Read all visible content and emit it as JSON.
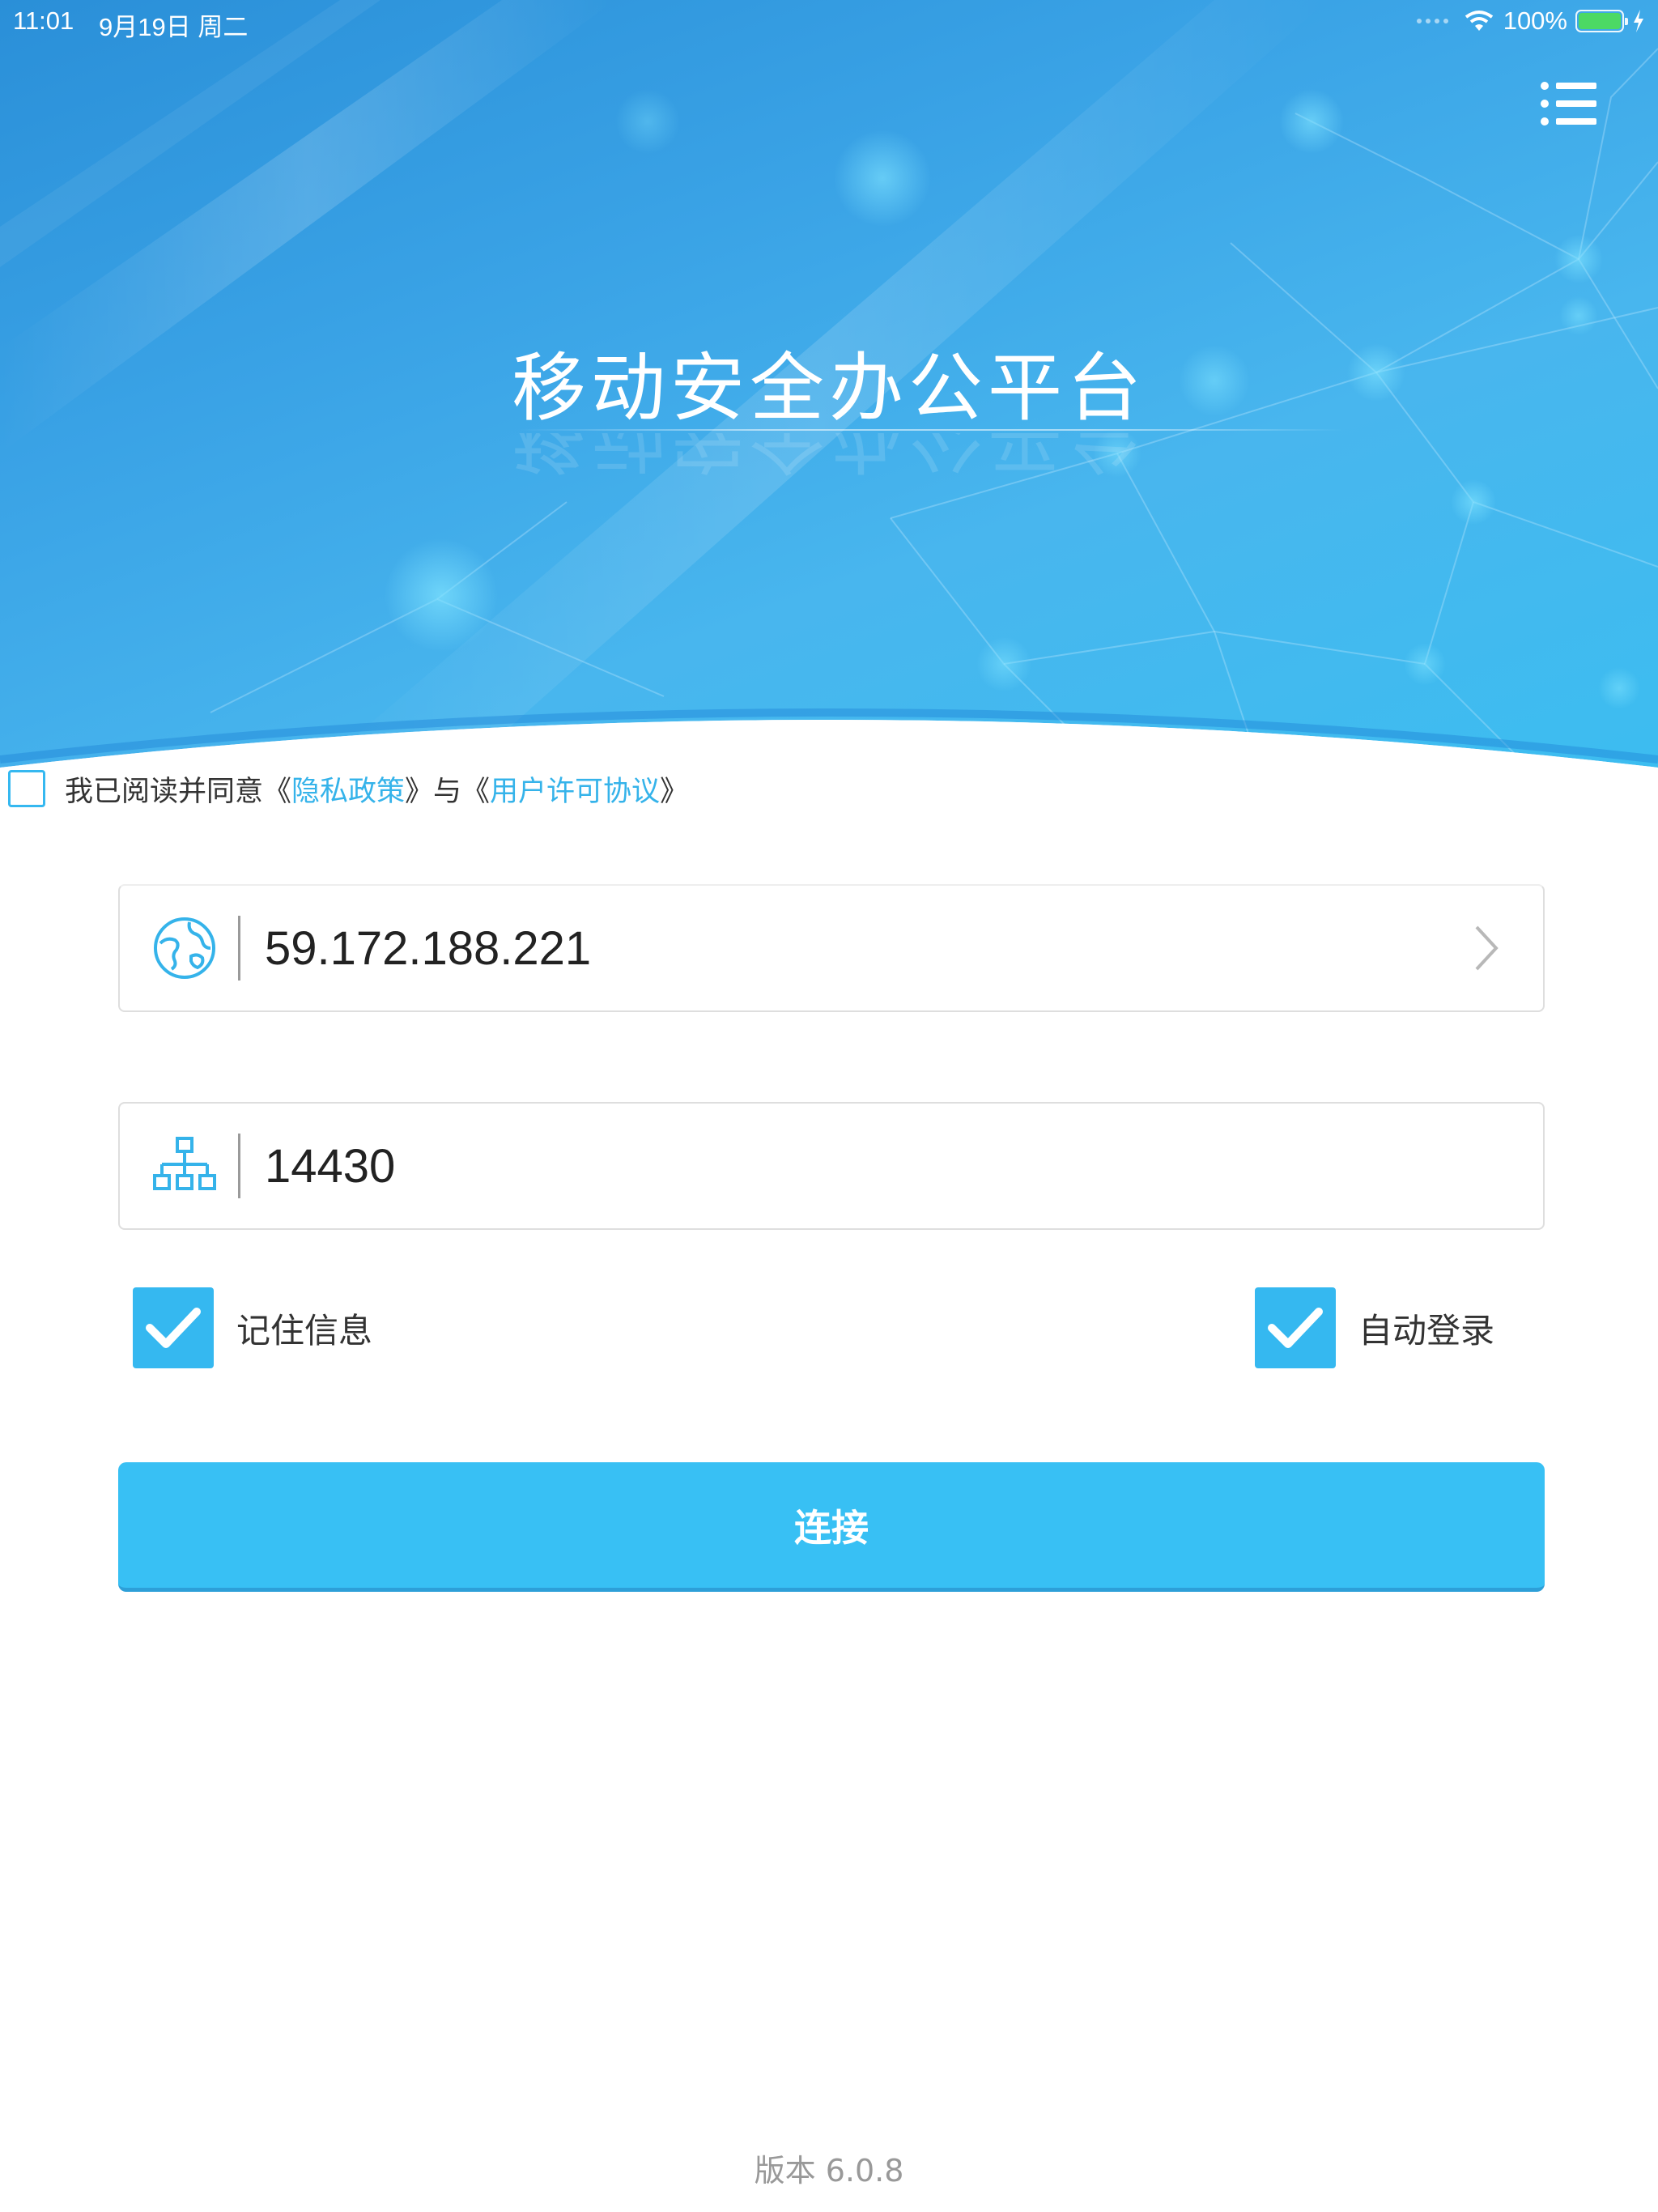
{
  "status_bar": {
    "time": "11:01",
    "date": "9月19日 周二",
    "battery": "100%",
    "battery_level": 1.0
  },
  "header": {
    "title": "移动安全办公平台",
    "menu_icon": "list-menu-icon"
  },
  "agreement": {
    "prefix": "我已阅读并同意《",
    "privacy_link": "隐私政策",
    "middle": "》与《",
    "license_link": "用户许可协议",
    "suffix": "》",
    "checked": false
  },
  "server": {
    "address": "59.172.188.221",
    "address_icon": "globe-icon",
    "port": "14430",
    "port_icon": "network-hierarchy-icon"
  },
  "options": {
    "remember_label": "记住信息",
    "remember_checked": true,
    "autologin_label": "自动登录",
    "autologin_checked": true
  },
  "connect_label": "连接",
  "version": "版本 6.0.8",
  "colors": {
    "accent": "#35b8f0",
    "button": "#38c0f4",
    "link": "#35b3ea",
    "battery": "#4cd964"
  }
}
